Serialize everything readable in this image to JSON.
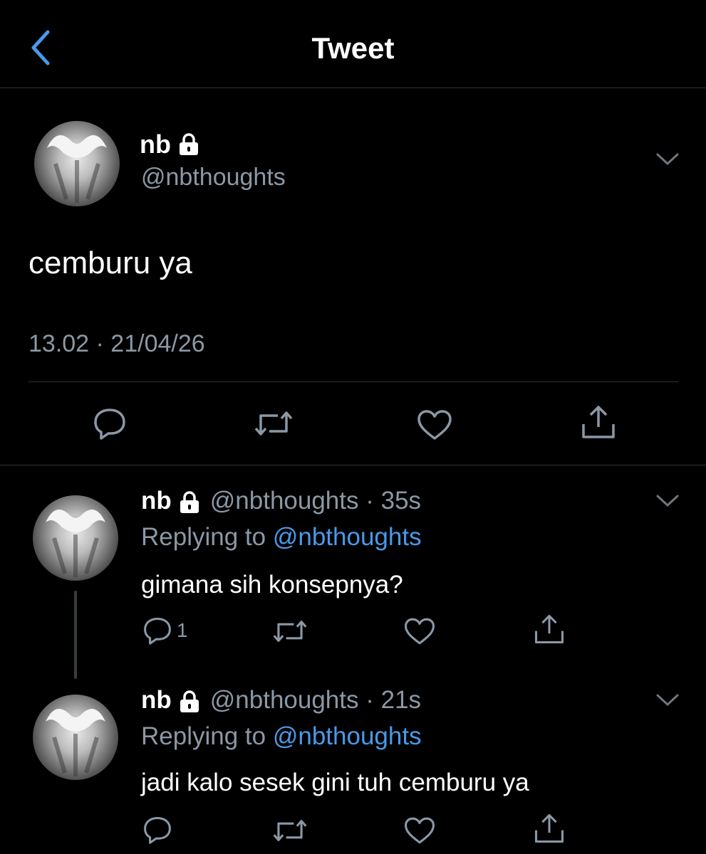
{
  "header": {
    "title": "Tweet",
    "back_icon": "chevron-left-icon"
  },
  "main_tweet": {
    "name": "nb",
    "handle": "@nbthoughts",
    "text": "cemburu ya",
    "timestamp": "13.02 · 21/04/26",
    "actions": [
      "reply-icon",
      "retweet-icon",
      "like-icon",
      "share-icon"
    ]
  },
  "replies": [
    {
      "name": "nb",
      "handle": "@nbthoughts",
      "separator": " · ",
      "time": "35s",
      "replying_label": "Replying to ",
      "replying_handle": "@nbthoughts",
      "text": "gimana sih konsepnya?",
      "reply_count": "1"
    },
    {
      "name": "nb",
      "handle": "@nbthoughts",
      "separator": " · ",
      "time": "21s",
      "replying_label": "Replying to ",
      "replying_handle": "@nbthoughts",
      "text": "jadi kalo sesek gini tuh cemburu ya",
      "reply_count": ""
    }
  ],
  "colors": {
    "accent": "#4a99e9",
    "muted": "#8b98a5",
    "background": "#000000",
    "divider": "#2f3336"
  }
}
